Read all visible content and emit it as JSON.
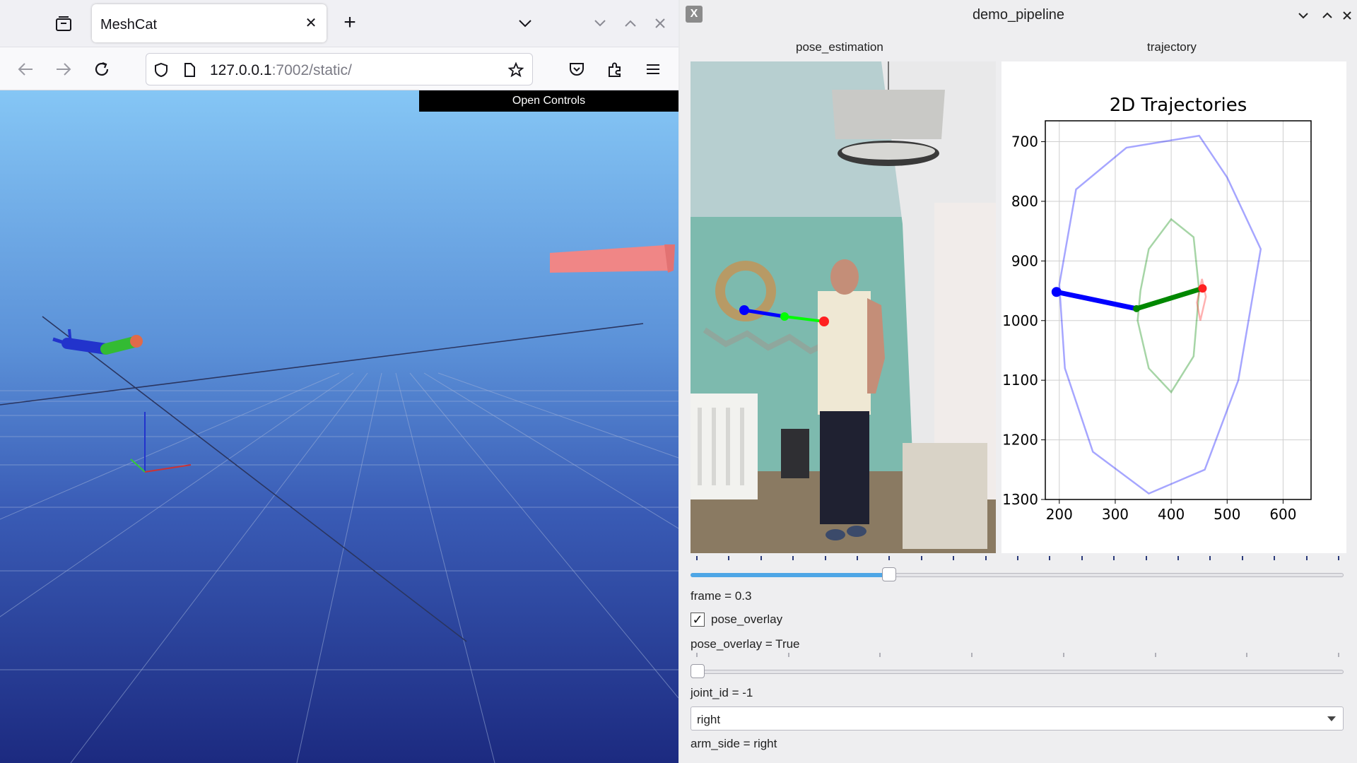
{
  "browser": {
    "tab_title": "MeshCat",
    "tab_close": "✕",
    "new_tab": "+",
    "url_host": "127.0.0.1",
    "url_rest": ":7002/static/",
    "icons": [
      "tab-list-icon",
      "chevron-down-icon",
      "back-icon",
      "forward-icon",
      "reload-icon",
      "shield-icon",
      "page-icon",
      "star-icon",
      "pocket-icon",
      "extensions-icon",
      "menu-icon",
      "minimize-icon",
      "maximize-icon",
      "close-icon"
    ]
  },
  "meshcat": {
    "open_controls": "Open Controls"
  },
  "app": {
    "window_title": "demo_pipeline",
    "x_logo": "X",
    "panels": {
      "left_label": "pose_estimation",
      "right_label": "trajectory"
    },
    "frame_slider": {
      "value": 0.3,
      "text": "frame = 0.3"
    },
    "pose_overlay": {
      "checked": true,
      "mark": "✓",
      "label": "pose_overlay",
      "text": "pose_overlay = True"
    },
    "joint_slider": {
      "value": -1,
      "text": "joint_id = -1"
    },
    "arm_side": {
      "selected": "right",
      "text": "arm_side = right"
    }
  },
  "chart_data": {
    "type": "line",
    "title": "2D Trajectories",
    "xlabel": "",
    "ylabel": "",
    "xlim": [
      175,
      650
    ],
    "ylim": [
      1300,
      665
    ],
    "xticks": [
      "200",
      "300",
      "400",
      "500",
      "600"
    ],
    "yticks": [
      "700",
      "800",
      "900",
      "1000",
      "1100",
      "1200",
      "1300"
    ],
    "grid": true,
    "current_arm": {
      "shoulder": [
        195,
        952
      ],
      "elbow": [
        338,
        980
      ],
      "wrist": [
        456,
        946
      ],
      "colors": [
        "#0000ff",
        "#008800",
        "#ff2020"
      ]
    },
    "series": [
      {
        "color": "#0000ff",
        "trajectory": [
          [
            200,
            940
          ],
          [
            230,
            780
          ],
          [
            320,
            710
          ],
          [
            450,
            690
          ],
          [
            500,
            760
          ],
          [
            560,
            880
          ],
          [
            520,
            1100
          ],
          [
            460,
            1250
          ],
          [
            360,
            1290
          ],
          [
            260,
            1220
          ],
          [
            210,
            1080
          ],
          [
            200,
            940
          ]
        ]
      },
      {
        "color": "#008800",
        "trajectory": [
          [
            345,
            950
          ],
          [
            360,
            880
          ],
          [
            400,
            830
          ],
          [
            440,
            860
          ],
          [
            450,
            950
          ],
          [
            440,
            1060
          ],
          [
            400,
            1120
          ],
          [
            360,
            1080
          ],
          [
            340,
            1000
          ],
          [
            345,
            950
          ]
        ]
      },
      {
        "color": "#ff2020",
        "trajectory": [
          [
            455,
            930
          ],
          [
            462,
            960
          ],
          [
            452,
            1000
          ],
          [
            446,
            970
          ],
          [
            455,
            930
          ]
        ]
      }
    ]
  }
}
